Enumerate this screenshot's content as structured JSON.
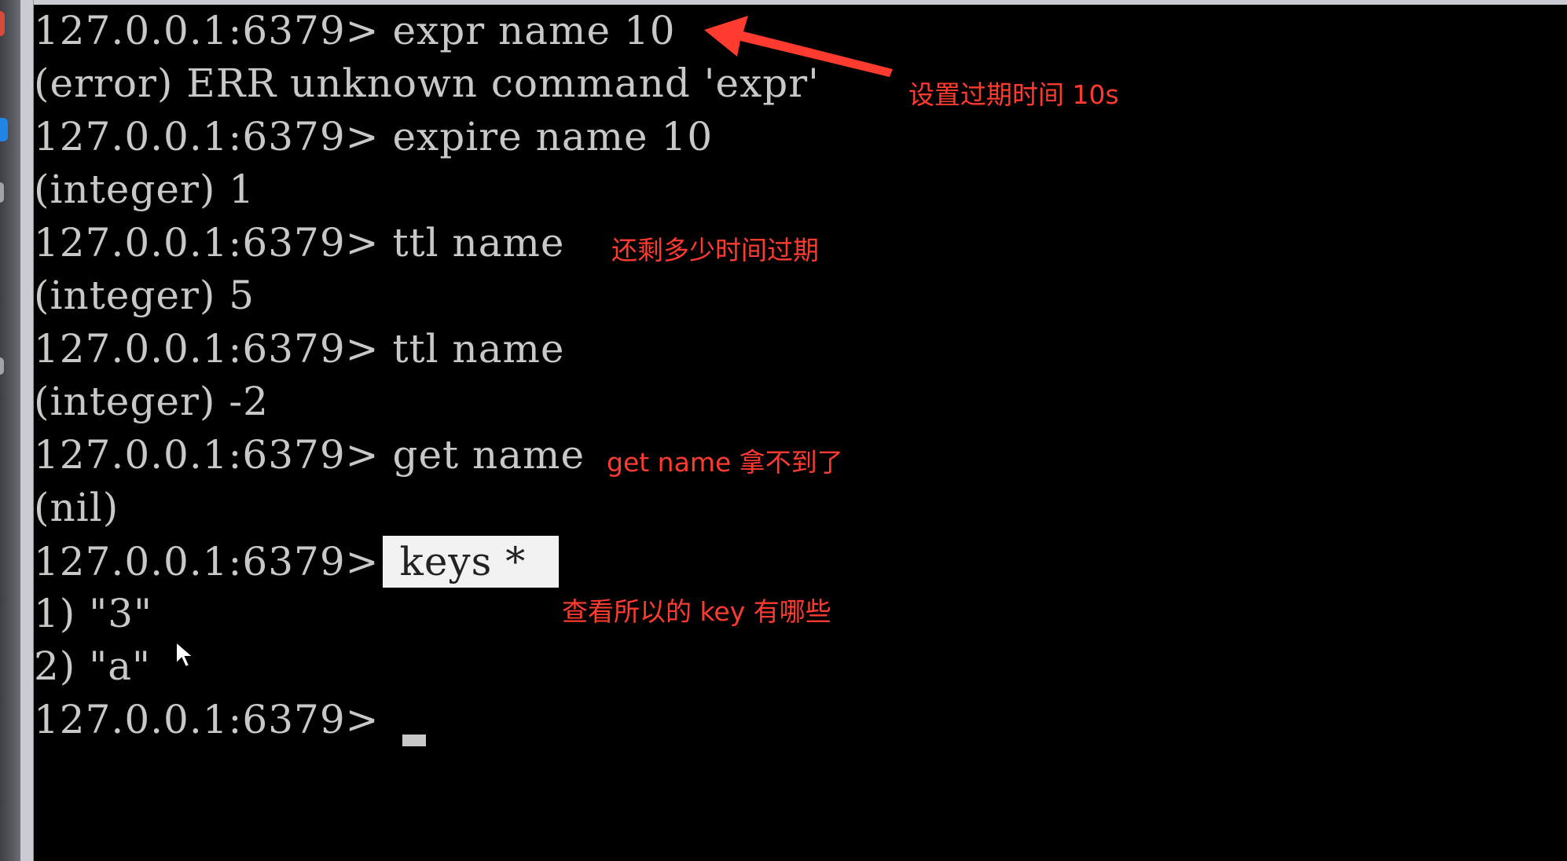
{
  "terminal": {
    "lines": [
      {
        "prompt": "127.0.0.1:6379>",
        "command": " expr name 10"
      },
      {
        "output": "(error) ERR unknown command 'expr'"
      },
      {
        "prompt": "127.0.0.1:6379>",
        "command": " expire name 10"
      },
      {
        "output": "(integer) 1"
      },
      {
        "prompt": "127.0.0.1:6379>",
        "command": " ttl name"
      },
      {
        "output": "(integer) 5"
      },
      {
        "prompt": "127.0.0.1:6379>",
        "command": " ttl name"
      },
      {
        "output": "(integer) -2"
      },
      {
        "prompt": "127.0.0.1:6379>",
        "command": " get name"
      },
      {
        "output": "(nil)"
      },
      {
        "prompt": "127.0.0.1:6379>",
        "command": "keys *"
      },
      {
        "output": "1) \"3\""
      },
      {
        "output": "2) \"a\""
      },
      {
        "prompt": "127.0.0.1:6379>",
        "command": ""
      }
    ]
  },
  "annotations": {
    "expire_note": "设置过期时间 10s",
    "ttl_note": "还剩多少时间过期",
    "get_note": "get name 拿不到了",
    "keys_note": "查看所以的 key 有哪些"
  },
  "colors": {
    "background": "#000000",
    "terminal_text": "#c8c8c8",
    "annotation": "#ff3b2f",
    "highlight_bg": "#f2f2f2"
  },
  "icons": {
    "arrow": "red-arrow-icon",
    "pointer": "mouse-pointer-icon"
  }
}
